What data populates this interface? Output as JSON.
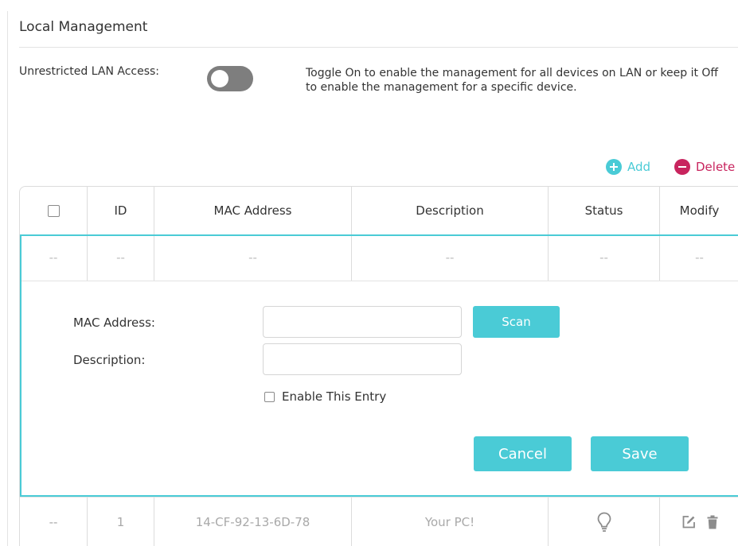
{
  "section": {
    "title": "Local Management"
  },
  "lan_access": {
    "label": "Unrestricted LAN Access:",
    "toggle_state": "off",
    "help": "Toggle On to enable the management for all devices on LAN or keep it Off to enable the management for a specific device."
  },
  "actions": {
    "add_label": "Add",
    "delete_label": "Delete",
    "add_color": "#4acbd6",
    "delete_color": "#c8245e"
  },
  "table": {
    "headers": [
      "ID",
      "MAC Address",
      "Description",
      "Status",
      "Modify"
    ],
    "placeholder_row": [
      "--",
      "--",
      "--",
      "--",
      "--",
      "--"
    ],
    "rows": [
      {
        "select": "--",
        "id": "1",
        "mac": "14-CF-92-13-6D-78",
        "description": "Your PC!",
        "status_icon": "lightbulb-icon",
        "modify_icons": [
          "edit-icon",
          "trash-icon"
        ]
      }
    ]
  },
  "form": {
    "mac_label": "MAC Address:",
    "mac_value": "",
    "description_label": "Description:",
    "description_value": "",
    "scan_label": "Scan",
    "enable_label": "Enable This Entry",
    "enable_checked": false,
    "cancel_label": "Cancel",
    "save_label": "Save"
  },
  "colors": {
    "accent": "#4acbd6",
    "danger": "#c8245e",
    "toggle_off": "#7e7e7e"
  }
}
